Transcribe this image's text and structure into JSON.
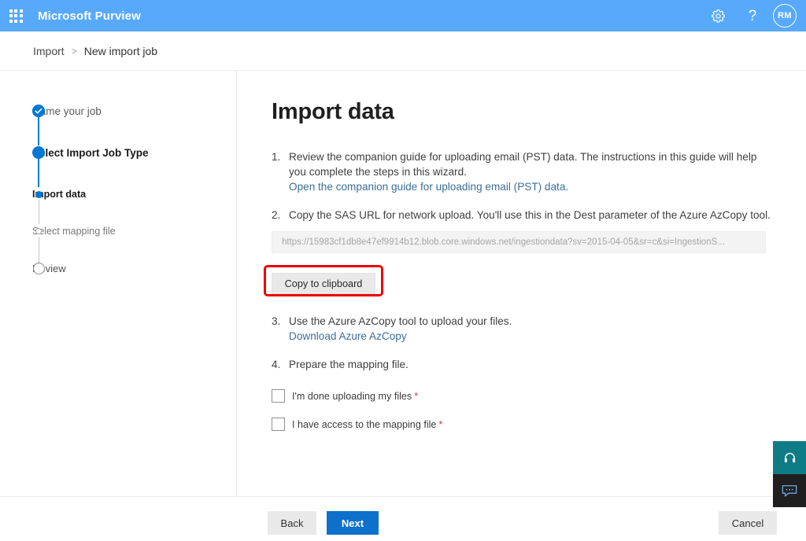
{
  "suite": {
    "waffle_icon": "app-launcher-icon",
    "brand": "Microsoft Purview",
    "settings_icon": "gear-icon",
    "help_icon": "question-mark-icon",
    "avatar_initials": "RM",
    "background_color": "#57a9fb"
  },
  "breadcrumb": {
    "items": [
      {
        "label": "Import"
      },
      {
        "label": "New import job"
      }
    ],
    "separator": ">"
  },
  "wizard": {
    "steps": [
      {
        "label": "Name your job",
        "state": "completed"
      },
      {
        "label": "Select Import Job Type",
        "state": "current"
      },
      {
        "label": "Import data",
        "state": "active"
      },
      {
        "label": "Select mapping file",
        "state": "pending"
      },
      {
        "label": "Review",
        "state": "pending"
      }
    ],
    "accent_color": "#0078d4"
  },
  "main": {
    "title": "Import data",
    "instructions": [
      {
        "num": "1.",
        "text": "Review the companion guide for uploading email (PST) data. The instructions in this guide will help you complete the steps in this wizard.",
        "link": "Open the companion guide for uploading email (PST) data."
      },
      {
        "num": "2.",
        "text": "Copy the SAS URL for network upload. You'll use this in the Dest parameter of the Azure AzCopy tool.",
        "link": ""
      },
      {
        "num": "3.",
        "text": "Use the Azure AzCopy tool to upload your files.",
        "link": "Download Azure AzCopy"
      },
      {
        "num": "4.",
        "text": "Prepare the mapping file.",
        "link": ""
      }
    ],
    "sas_url": "https://15983cf1db8e47ef9914b12.blob.core.windows.net/ingestiondata?sv=2015-04-05&sr=c&si=IngestionS...",
    "copy_button": "Copy to clipboard",
    "copy_highlight_color": "#ee0000",
    "checkboxes": [
      {
        "label": "I'm done uploading my files",
        "required_marker": "*",
        "checked": false
      },
      {
        "label": "I have access to the mapping file",
        "required_marker": "*",
        "checked": false
      }
    ],
    "link_color": "#3b6e98"
  },
  "footer": {
    "back_label": "Back",
    "next_label": "Next",
    "cancel_label": "Cancel",
    "primary_color": "#0d70ca"
  },
  "widgets": {
    "help_icon": "headset-icon",
    "help_color": "#0e7c86",
    "feedback_icon": "chat-bubble-icon",
    "feedback_color": "#1f1f1f"
  }
}
